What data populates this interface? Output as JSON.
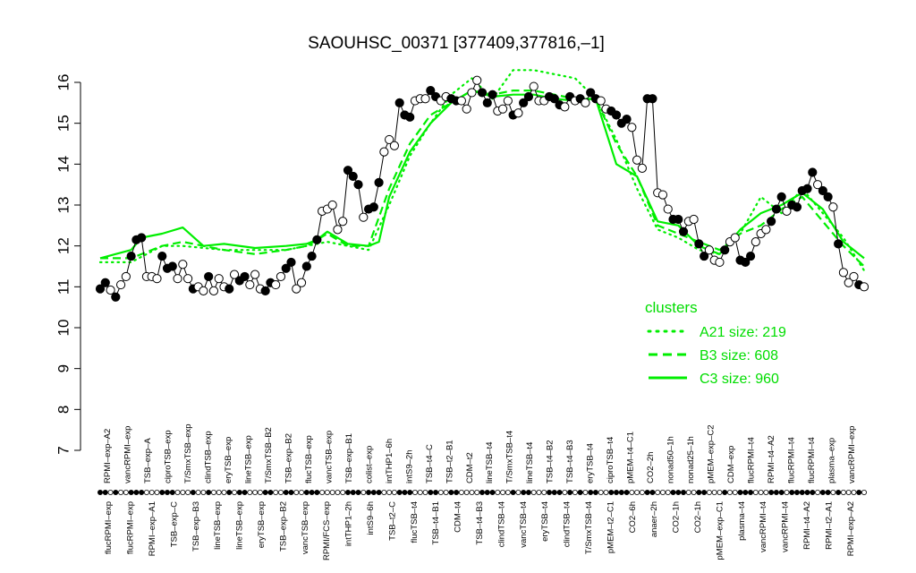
{
  "chart_data": {
    "type": "line",
    "title": "SAOUHSC_00371 [377409,377816,–1]",
    "ylim": [
      7,
      16
    ],
    "yticks": [
      7,
      8,
      9,
      10,
      11,
      12,
      13,
      14,
      15,
      16
    ],
    "colors": {
      "cluster_line": "#00ee00",
      "points_black": "#000000",
      "points_white": "#ffffff",
      "legend_text": "#00dd00"
    },
    "x_labels_top": [
      "RPMI–exp–A2",
      "vancRPMI–exp",
      "TSB–exp–A",
      "ciproTSB–exp",
      "T/SmxTSB–exp",
      "clindTSB–exp",
      "eryTSB–exp",
      "lineTSB–exp",
      "T/SmxTSB–B2",
      "TSB–exp–B2",
      "flucTSB–exp",
      "vancTSB–exp",
      "TSB–exp–B1",
      "colist–exp",
      "intTHP1–6h",
      "intS9–2h",
      "TSB–t4–C",
      "TSB–t2–B1",
      "CDM–t2",
      "lineTSB–t4",
      "T/SmxTSB–t4",
      "lineTSB–t4",
      "TSB–t4–B2",
      "TSB–t4–B3",
      "eryTSB–t4",
      "ciproTSB–t4",
      "pMEM–t4–C1",
      "CO2–2h",
      "nonad50–1h",
      "nonad25–1h",
      "pMEM–exp–C2",
      "CDM–exp",
      "flucRPMI–t4",
      "RPMI–t4–A2",
      "flucRPMI–t4",
      "flucRPMI–t4",
      "plasma–exp",
      "vancRPMI–exp"
    ],
    "x_labels_bottom": [
      "flucRPMI–exp",
      "flucRPMI–exp",
      "RPMI–exp–A1",
      "TSB–exp–C",
      "TSB–exp–B3",
      "lineTSB–exp",
      "lineTSB–exp",
      "eryTSB–exp",
      "TSB–exp–B2",
      "vancTSB–exp",
      "RPMI/FCS–exp",
      "intTHP1–2h",
      "intS9–6h",
      "TSB–t2–C",
      "flucTSB–t4",
      "TSB–t4–B1",
      "CDM–t4",
      "TSB–t4–B3",
      "clindTSB–t4",
      "vancTSB–t4",
      "eryTSB–t4",
      "clindTSB–t4",
      "T/SmxTSB–t4",
      "pMEM–t2–C1",
      "CO2–6h",
      "anaer–2h",
      "CO2–1h",
      "CO2–1h",
      "pMEM–exp–C1",
      "plasma–t4",
      "vancRPMI–t4",
      "vancRPMI–t4",
      "RPMI–t4–A2",
      "RPMI–t2–A1",
      "RPMI–exp–A2"
    ],
    "legend": {
      "title": "clusters",
      "entries": [
        {
          "label": "A21 size: 219",
          "style": "dotted"
        },
        {
          "label": "B3 size: 608",
          "style": "dashed"
        },
        {
          "label": "C3 size: 960",
          "style": "solid"
        }
      ],
      "position": "right"
    },
    "points": [
      [
        1,
        10.95,
        "b"
      ],
      [
        2,
        11.1,
        "b"
      ],
      [
        3,
        10.92,
        "w"
      ],
      [
        4,
        10.75,
        "b"
      ],
      [
        5,
        11.05,
        "w"
      ],
      [
        6,
        11.25,
        "w"
      ],
      [
        7,
        11.75,
        "b"
      ],
      [
        8,
        12.15,
        "b"
      ],
      [
        9,
        12.2,
        "b"
      ],
      [
        10,
        11.25,
        "w"
      ],
      [
        11,
        11.25,
        "w"
      ],
      [
        12,
        11.2,
        "w"
      ],
      [
        13,
        11.75,
        "b"
      ],
      [
        14,
        11.45,
        "b"
      ],
      [
        15,
        11.5,
        "b"
      ],
      [
        16,
        11.2,
        "w"
      ],
      [
        17,
        11.55,
        "w"
      ],
      [
        18,
        11.2,
        "w"
      ],
      [
        19,
        10.95,
        "b"
      ],
      [
        20,
        11.0,
        "w"
      ],
      [
        21,
        10.9,
        "w"
      ],
      [
        22,
        11.25,
        "b"
      ],
      [
        23,
        10.9,
        "w"
      ],
      [
        24,
        11.2,
        "w"
      ],
      [
        25,
        11.0,
        "w"
      ],
      [
        26,
        10.95,
        "b"
      ],
      [
        27,
        11.3,
        "w"
      ],
      [
        28,
        11.15,
        "b"
      ],
      [
        29,
        11.25,
        "b"
      ],
      [
        30,
        11.05,
        "w"
      ],
      [
        31,
        11.3,
        "w"
      ],
      [
        32,
        10.95,
        "w"
      ],
      [
        33,
        10.9,
        "b"
      ],
      [
        34,
        11.1,
        "b"
      ],
      [
        35,
        11.05,
        "w"
      ],
      [
        36,
        11.25,
        "w"
      ],
      [
        37,
        11.45,
        "b"
      ],
      [
        38,
        11.6,
        "b"
      ],
      [
        39,
        10.95,
        "w"
      ],
      [
        40,
        11.1,
        "w"
      ],
      [
        41,
        11.5,
        "b"
      ],
      [
        42,
        11.75,
        "b"
      ],
      [
        43,
        12.15,
        "b"
      ],
      [
        44,
        12.85,
        "w"
      ],
      [
        45,
        12.9,
        "w"
      ],
      [
        46,
        13.0,
        "w"
      ],
      [
        47,
        12.4,
        "w"
      ],
      [
        48,
        12.6,
        "w"
      ],
      [
        49,
        13.85,
        "b"
      ],
      [
        50,
        13.7,
        "b"
      ],
      [
        51,
        13.5,
        "b"
      ],
      [
        52,
        12.7,
        "w"
      ],
      [
        53,
        12.9,
        "b"
      ],
      [
        54,
        12.95,
        "b"
      ],
      [
        55,
        13.55,
        "b"
      ],
      [
        56,
        14.3,
        "w"
      ],
      [
        57,
        14.6,
        "w"
      ],
      [
        58,
        14.45,
        "w"
      ],
      [
        59,
        15.5,
        "b"
      ],
      [
        60,
        15.2,
        "b"
      ],
      [
        61,
        15.15,
        "b"
      ],
      [
        62,
        15.55,
        "w"
      ],
      [
        63,
        15.6,
        "w"
      ],
      [
        64,
        15.6,
        "w"
      ],
      [
        65,
        15.8,
        "b"
      ],
      [
        66,
        15.65,
        "b"
      ],
      [
        67,
        15.55,
        "w"
      ],
      [
        68,
        15.65,
        "w"
      ],
      [
        69,
        15.6,
        "b"
      ],
      [
        70,
        15.55,
        "b"
      ],
      [
        71,
        15.55,
        "w"
      ],
      [
        72,
        15.35,
        "w"
      ],
      [
        73,
        15.75,
        "w"
      ],
      [
        74,
        16.05,
        "w"
      ],
      [
        75,
        15.75,
        "b"
      ],
      [
        76,
        15.5,
        "b"
      ],
      [
        77,
        15.7,
        "b"
      ],
      [
        78,
        15.3,
        "w"
      ],
      [
        79,
        15.35,
        "w"
      ],
      [
        80,
        15.55,
        "w"
      ],
      [
        81,
        15.2,
        "b"
      ],
      [
        82,
        15.25,
        "w"
      ],
      [
        83,
        15.5,
        "b"
      ],
      [
        84,
        15.65,
        "b"
      ],
      [
        85,
        15.9,
        "w"
      ],
      [
        86,
        15.55,
        "w"
      ],
      [
        87,
        15.55,
        "w"
      ],
      [
        88,
        15.65,
        "b"
      ],
      [
        89,
        15.6,
        "b"
      ],
      [
        90,
        15.45,
        "b"
      ],
      [
        91,
        15.4,
        "w"
      ],
      [
        92,
        15.65,
        "b"
      ],
      [
        93,
        15.55,
        "w"
      ],
      [
        94,
        15.6,
        "b"
      ],
      [
        95,
        15.5,
        "w"
      ],
      [
        96,
        15.75,
        "b"
      ],
      [
        97,
        15.6,
        "b"
      ],
      [
        98,
        15.55,
        "w"
      ],
      [
        99,
        15.35,
        "w"
      ],
      [
        100,
        15.3,
        "b"
      ],
      [
        101,
        15.2,
        "b"
      ],
      [
        102,
        15.0,
        "b"
      ],
      [
        103,
        15.1,
        "b"
      ],
      [
        104,
        14.9,
        "w"
      ],
      [
        105,
        14.1,
        "w"
      ],
      [
        106,
        13.9,
        "w"
      ],
      [
        107,
        15.6,
        "b"
      ],
      [
        108,
        15.6,
        "b"
      ],
      [
        109,
        13.3,
        "w"
      ],
      [
        110,
        13.25,
        "w"
      ],
      [
        111,
        12.9,
        "w"
      ],
      [
        112,
        12.65,
        "b"
      ],
      [
        113,
        12.65,
        "b"
      ],
      [
        114,
        12.35,
        "b"
      ],
      [
        115,
        12.6,
        "w"
      ],
      [
        116,
        12.65,
        "w"
      ],
      [
        117,
        12.05,
        "b"
      ],
      [
        118,
        11.75,
        "b"
      ],
      [
        119,
        11.9,
        "w"
      ],
      [
        120,
        11.65,
        "w"
      ],
      [
        121,
        11.6,
        "w"
      ],
      [
        122,
        11.9,
        "b"
      ],
      [
        123,
        12.1,
        "w"
      ],
      [
        124,
        12.2,
        "w"
      ],
      [
        125,
        11.65,
        "b"
      ],
      [
        126,
        11.6,
        "b"
      ],
      [
        127,
        11.75,
        "b"
      ],
      [
        128,
        12.1,
        "w"
      ],
      [
        129,
        12.3,
        "w"
      ],
      [
        130,
        12.4,
        "w"
      ],
      [
        131,
        12.6,
        "b"
      ],
      [
        132,
        12.9,
        "b"
      ],
      [
        133,
        13.2,
        "b"
      ],
      [
        134,
        12.85,
        "w"
      ],
      [
        135,
        13.0,
        "b"
      ],
      [
        136,
        12.95,
        "b"
      ],
      [
        137,
        13.35,
        "b"
      ],
      [
        138,
        13.4,
        "b"
      ],
      [
        139,
        13.8,
        "b"
      ],
      [
        140,
        13.5,
        "w"
      ],
      [
        141,
        13.35,
        "b"
      ],
      [
        142,
        13.2,
        "b"
      ],
      [
        143,
        12.95,
        "w"
      ],
      [
        144,
        12.05,
        "b"
      ],
      [
        145,
        11.35,
        "w"
      ],
      [
        146,
        11.1,
        "w"
      ],
      [
        147,
        11.25,
        "w"
      ],
      [
        148,
        11.05,
        "b"
      ],
      [
        149,
        11.0,
        "w"
      ]
    ],
    "series": [
      {
        "name": "A21",
        "style": "dotted",
        "x": [
          1,
          7,
          13,
          17,
          25,
          31,
          37,
          41,
          45,
          49,
          53,
          57,
          61,
          65,
          69,
          73,
          77,
          81,
          85,
          89,
          93,
          97,
          101,
          105,
          109,
          113,
          117,
          121,
          125,
          129,
          133,
          137,
          141,
          145,
          149
        ],
        "values": [
          11.6,
          11.6,
          12.0,
          12.0,
          11.9,
          11.9,
          11.9,
          12.0,
          12.1,
          12.0,
          11.9,
          13.0,
          14.2,
          15.0,
          15.7,
          16.1,
          15.6,
          16.3,
          16.3,
          16.2,
          16.1,
          15.6,
          14.6,
          13.4,
          12.4,
          12.2,
          11.9,
          11.8,
          12.3,
          13.2,
          12.8,
          13.4,
          12.8,
          12.2,
          11.4
        ]
      },
      {
        "name": "B3",
        "style": "dashed",
        "x": [
          1,
          7,
          13,
          17,
          25,
          31,
          37,
          41,
          45,
          49,
          53,
          57,
          61,
          65,
          69,
          73,
          77,
          81,
          85,
          89,
          93,
          97,
          101,
          105,
          109,
          113,
          117,
          121,
          125,
          129,
          133,
          137,
          141,
          145,
          149
        ],
        "values": [
          11.7,
          11.7,
          12.0,
          12.1,
          11.9,
          11.8,
          11.9,
          12.0,
          12.3,
          12.0,
          12.0,
          13.4,
          14.5,
          15.2,
          15.5,
          15.8,
          15.7,
          15.8,
          15.8,
          15.7,
          15.6,
          15.6,
          14.5,
          13.7,
          12.5,
          12.3,
          12.1,
          11.9,
          12.3,
          12.5,
          12.9,
          13.2,
          12.6,
          12.0,
          11.5
        ]
      },
      {
        "name": "C3",
        "style": "solid",
        "x": [
          1,
          7,
          9,
          13,
          17,
          21,
          25,
          31,
          37,
          41,
          43,
          45,
          49,
          53,
          55,
          57,
          61,
          65,
          69,
          73,
          77,
          81,
          85,
          89,
          93,
          97,
          101,
          105,
          109,
          113,
          117,
          121,
          125,
          129,
          133,
          137,
          141,
          145,
          149
        ],
        "values": [
          11.7,
          11.9,
          12.2,
          12.3,
          12.45,
          12.0,
          12.05,
          11.95,
          12.0,
          12.05,
          12.15,
          12.35,
          12.05,
          12.0,
          12.1,
          13.2,
          14.3,
          15.0,
          15.5,
          15.8,
          15.65,
          15.7,
          15.7,
          15.6,
          15.55,
          15.6,
          14.0,
          13.7,
          12.6,
          12.5,
          12.0,
          11.8,
          12.4,
          12.8,
          13.0,
          13.3,
          12.9,
          12.1,
          11.7
        ]
      }
    ],
    "dot_groups": [
      [
        1,
        9
      ],
      [
        11,
        13
      ],
      [
        17,
        18
      ],
      [
        21,
        29
      ],
      [
        30,
        32
      ],
      [
        34,
        36
      ],
      [
        38,
        39
      ],
      [
        42,
        45
      ],
      [
        47,
        49
      ],
      [
        52,
        54
      ],
      [
        56,
        58
      ],
      [
        61,
        63
      ],
      [
        66,
        69
      ],
      [
        72,
        80
      ],
      [
        85,
        90
      ],
      [
        92,
        95
      ],
      [
        99,
        103
      ],
      [
        109,
        112
      ],
      [
        115,
        120
      ],
      [
        124,
        127
      ],
      [
        130,
        133
      ],
      [
        137,
        141
      ],
      [
        143,
        145
      ],
      [
        149,
        151
      ]
    ]
  }
}
